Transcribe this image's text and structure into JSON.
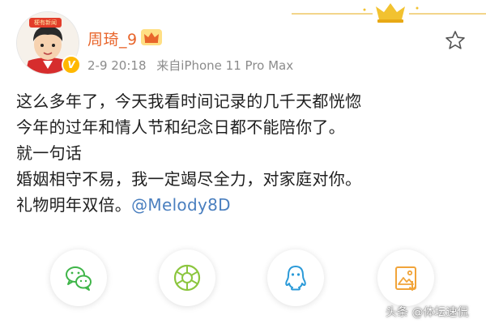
{
  "header": {
    "avatar_banner": "梗有新闻",
    "username": "周琦_9",
    "date": "2-9 20:18",
    "source": "来自iPhone 11 Pro Max"
  },
  "post": {
    "lines": [
      "这么多年了，今天我看时间记录的几千天都恍惚",
      "今年的过年和情人节和纪念日都不能陪你了。",
      "就一句话",
      "婚姻相守不易，我一定竭尽全力，对家庭对你。"
    ],
    "last_line_text": "礼物明年双倍。",
    "mention": "@Melody8D"
  },
  "share": {
    "buttons": [
      {
        "icon": "wechat-icon",
        "color": "#3fb549"
      },
      {
        "icon": "moments-icon",
        "color": "#8cc63f"
      },
      {
        "icon": "qq-icon",
        "color": "#2b9ad8"
      },
      {
        "icon": "save-image-icon",
        "color": "#f1a43a"
      }
    ]
  },
  "watermark": "头条 @体坛速侃",
  "colors": {
    "username": "#e8652b",
    "mention": "#4a7fbf",
    "meta": "#8b8b8b",
    "vip_badge": "#ffb800"
  }
}
